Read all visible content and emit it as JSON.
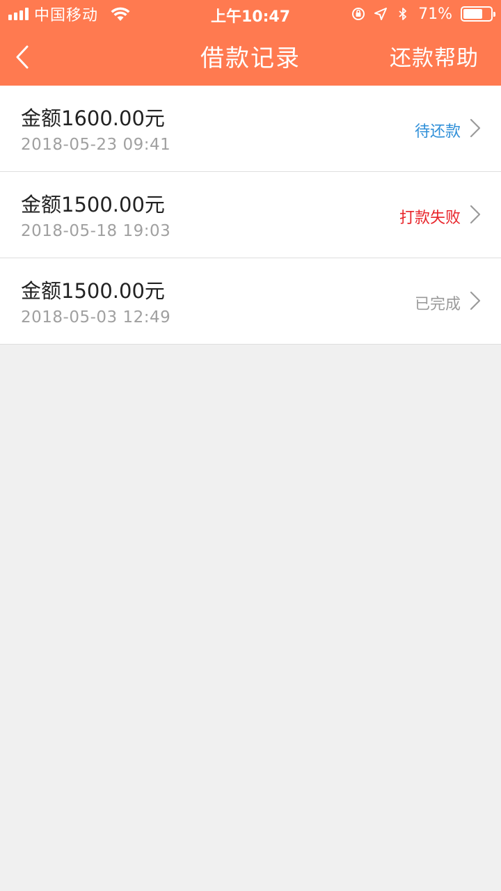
{
  "status_bar": {
    "carrier": "中国移动",
    "time": "上午10:47",
    "battery_percent": "71%",
    "battery_level": 0.71
  },
  "nav": {
    "title": "借款记录",
    "help_label": "还款帮助",
    "back_icon": "chevron-left-icon"
  },
  "colors": {
    "header_bg": "#ff7a50",
    "status_pending": "#2f8fd8",
    "status_failed": "#e8242a",
    "status_done": "#9a9a9a"
  },
  "records": [
    {
      "amount": "金额1600.00元",
      "datetime": "2018-05-23 09:41",
      "status": "待还款",
      "status_type": "pending"
    },
    {
      "amount": "金额1500.00元",
      "datetime": "2018-05-18 19:03",
      "status": "打款失败",
      "status_type": "failed"
    },
    {
      "amount": "金额1500.00元",
      "datetime": "2018-05-03 12:49",
      "status": "已完成",
      "status_type": "done"
    }
  ]
}
